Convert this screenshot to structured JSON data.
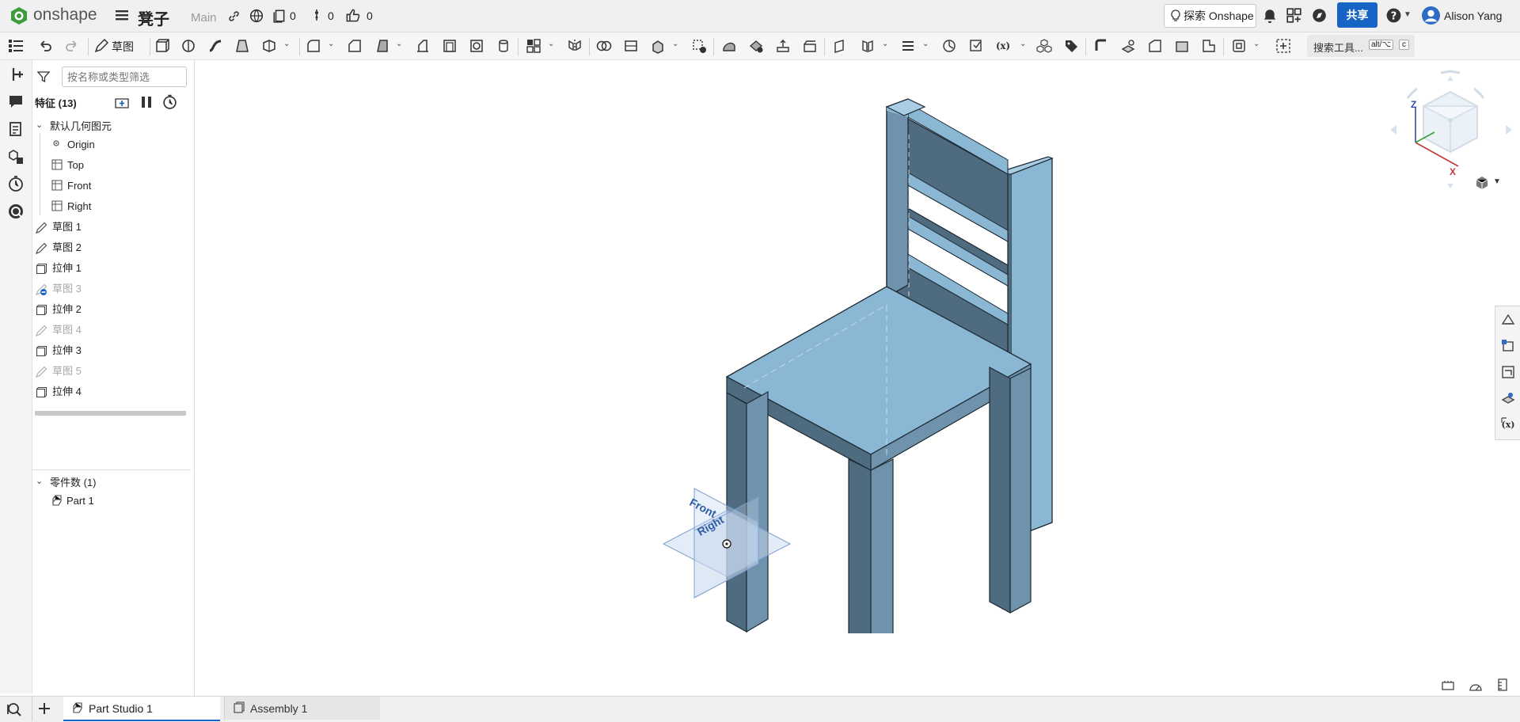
{
  "app": {
    "brand": "onshape",
    "doc_title": "凳子",
    "branch": "Main",
    "counters": {
      "versions": "0",
      "branches": "0",
      "likes": "0"
    }
  },
  "header": {
    "explore_label": "探索 Onshape",
    "share_label": "共享",
    "user_name": "Alison Yang"
  },
  "toolbar": {
    "sketch_label": "草图",
    "search_label": "搜索工具...",
    "shortcut_key1": "alt/⌥",
    "shortcut_key2": "c"
  },
  "panel": {
    "filter_placeholder": "按名称或类型筛选",
    "features_header": "特征 (13)",
    "default_geometry": "默认几何图元",
    "geometry_items": [
      "Origin",
      "Top",
      "Front",
      "Right"
    ],
    "features": [
      {
        "label": "草图 1",
        "kind": "sketch",
        "dim": false
      },
      {
        "label": "草图 2",
        "kind": "sketch",
        "dim": false
      },
      {
        "label": "拉伸 1",
        "kind": "extrude",
        "dim": false
      },
      {
        "label": "草图 3",
        "kind": "sketch-hidden",
        "dim": true
      },
      {
        "label": "拉伸 2",
        "kind": "extrude",
        "dim": false
      },
      {
        "label": "草图 4",
        "kind": "sketch",
        "dim": true
      },
      {
        "label": "拉伸 3",
        "kind": "extrude",
        "dim": false
      },
      {
        "label": "草图 5",
        "kind": "sketch",
        "dim": true
      },
      {
        "label": "拉伸 4",
        "kind": "extrude",
        "dim": false
      }
    ],
    "parts_header": "零件数 (1)",
    "parts": [
      "Part 1"
    ]
  },
  "viewport": {
    "plane_labels": {
      "front": "Front",
      "right": "Right"
    },
    "viewcube": {
      "axis_z": "Z",
      "axis_x": "X"
    }
  },
  "tabs": [
    {
      "label": "Part Studio 1",
      "active": true
    },
    {
      "label": "Assembly 1",
      "active": false
    }
  ],
  "colors": {
    "accent": "#1764c4",
    "chair_face": "#8ab7d4",
    "chair_dark": "#4f6b80",
    "chair_mid": "#6f93ad",
    "plane": "#c9daf0"
  }
}
